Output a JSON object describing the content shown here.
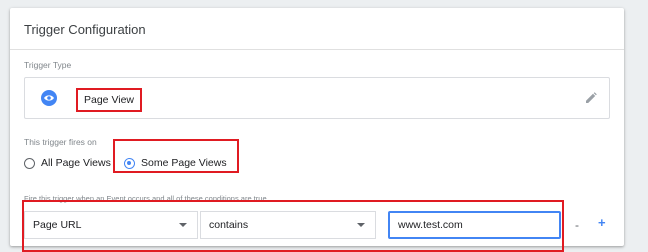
{
  "header": {
    "title": "Trigger Configuration"
  },
  "trigger_type": {
    "label": "Trigger Type",
    "name": "Page View",
    "icon": "eye-icon",
    "edit_icon": "pencil-icon"
  },
  "fires_on": {
    "label": "This trigger fires on",
    "options": [
      {
        "label": "All Page Views",
        "checked": false
      },
      {
        "label": "Some Page Views",
        "checked": true
      }
    ]
  },
  "conditions": {
    "label": "Fire this trigger when an Event occurs and all of these conditions are true",
    "variable": "Page URL",
    "operator": "contains",
    "value": "www.test.com",
    "remove_label": "-",
    "add_label": "+"
  },
  "colors": {
    "accent": "#4285f4",
    "highlight": "#e01b22"
  }
}
